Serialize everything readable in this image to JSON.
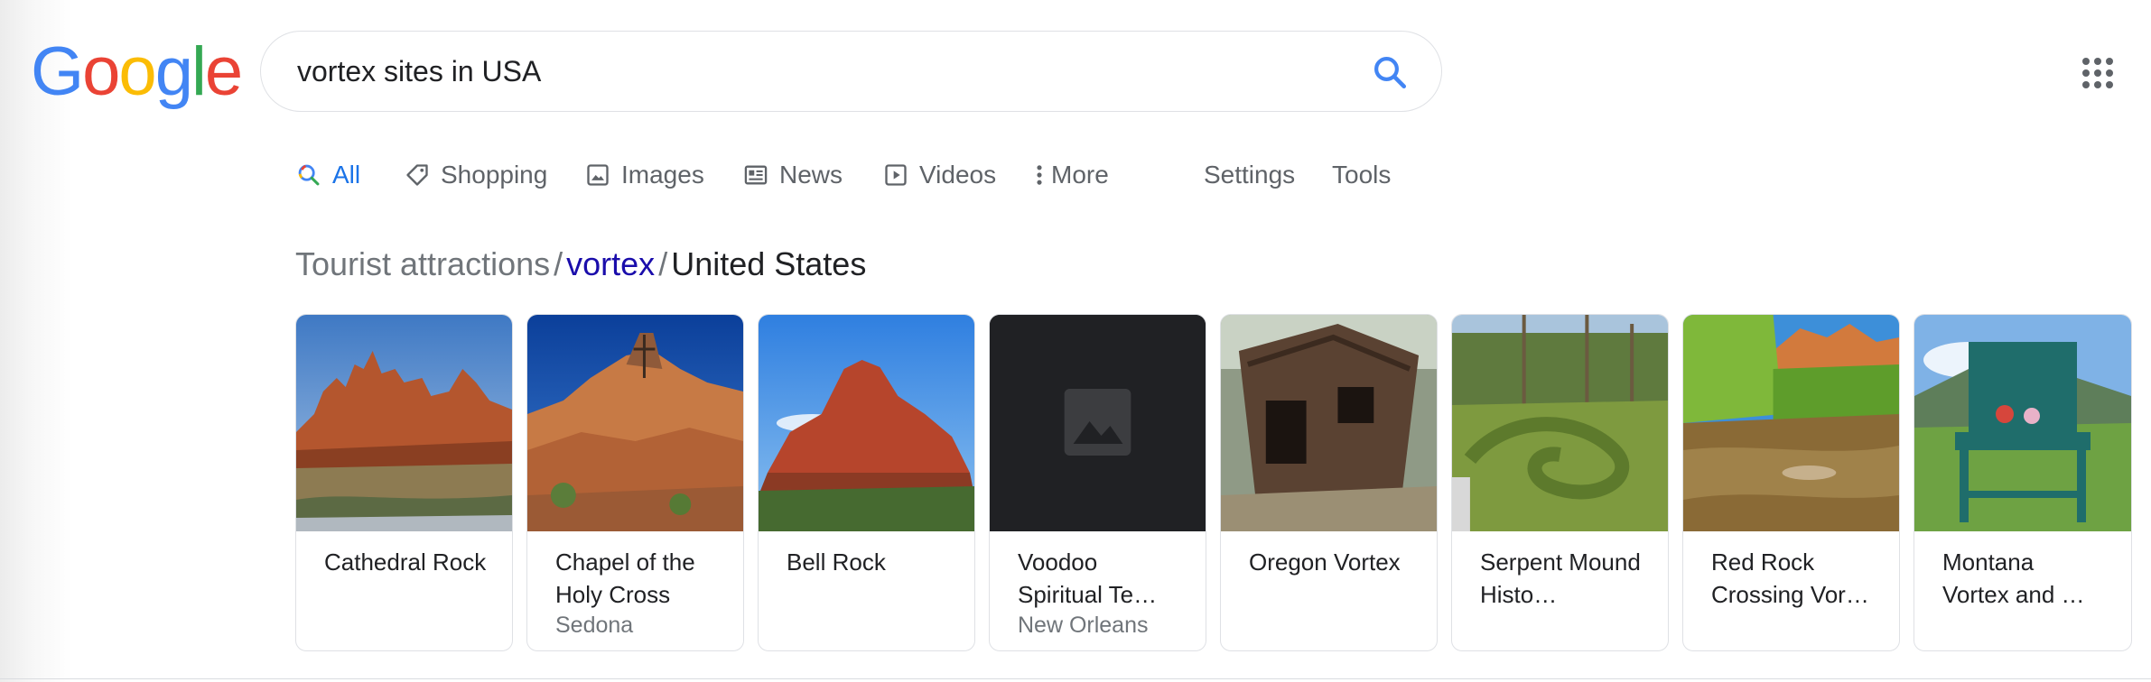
{
  "logo": {
    "letters": [
      "G",
      "o",
      "o",
      "g",
      "l",
      "e"
    ],
    "colors": [
      "#4285f4",
      "#ea4335",
      "#fbbc05",
      "#4285f4",
      "#34a853",
      "#ea4335"
    ]
  },
  "search": {
    "query": "vortex sites in USA",
    "icon": "search-icon"
  },
  "apps": {
    "icon": "apps-grid-icon"
  },
  "tabs": [
    {
      "label": "All",
      "icon": "search-icon",
      "active": true
    },
    {
      "label": "Shopping",
      "icon": "tag-icon"
    },
    {
      "label": "Images",
      "icon": "image-icon"
    },
    {
      "label": "News",
      "icon": "newspaper-icon"
    },
    {
      "label": "Videos",
      "icon": "play-icon"
    },
    {
      "label": "More",
      "icon": "more-vertical-icon"
    },
    {
      "label": "Settings"
    },
    {
      "label": "Tools"
    }
  ],
  "breadcrumb": {
    "part1": "Tourist attractions",
    "sep": "/",
    "part2": "vortex",
    "part3": "United States"
  },
  "cards": [
    {
      "title": "Cathedral Rock",
      "subtitle": "",
      "image": "red-rock-formation-photo"
    },
    {
      "title": "Chapel of the Holy Cross",
      "subtitle": "Sedona",
      "image": "chapel-on-rocks-photo"
    },
    {
      "title": "Bell Rock",
      "subtitle": "",
      "image": "butte-blue-sky-photo"
    },
    {
      "title": "Voodoo Spiritual Te…",
      "subtitle": "New Orleans",
      "image": "image-placeholder-icon"
    },
    {
      "title": "Oregon Vortex",
      "subtitle": "",
      "image": "leaning-wooden-shack-photo"
    },
    {
      "title": "Serpent Mound Histo…",
      "subtitle": "",
      "image": "grassy-mound-photo"
    },
    {
      "title": "Red Rock Crossing Vor…",
      "subtitle": "",
      "image": "creek-red-rocks-photo"
    },
    {
      "title": "Montana Vortex and …",
      "subtitle": "",
      "image": "giant-green-chair-photo"
    }
  ],
  "colors": {
    "accent": "#1a73e8",
    "link": "#1a0dab",
    "text": "#202124",
    "muted": "#70757a"
  }
}
